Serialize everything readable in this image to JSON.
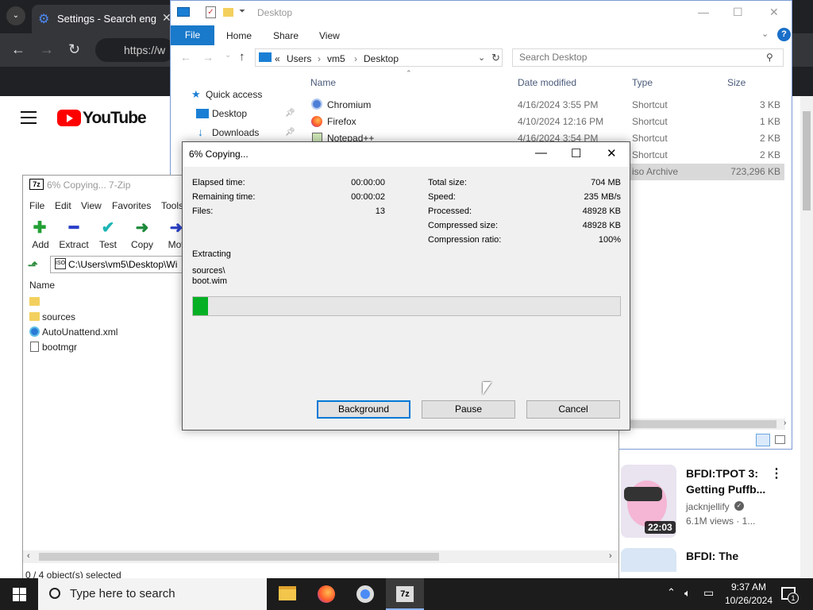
{
  "browser": {
    "tab_title": "Settings - Search engi",
    "url": "https://w",
    "youtube_logo_text": "YouTube",
    "video": {
      "title": "BFDI:TPOT 3: Getting Puffb...",
      "channel": "jacknjellify",
      "views": "6.1M views · 1...",
      "duration": "22:03"
    },
    "video2_title": "BFDI: The"
  },
  "explorer": {
    "title": "Desktop",
    "ribbon_tabs": [
      "File",
      "Home",
      "Share",
      "View"
    ],
    "breadcrumb": [
      "«",
      "Users",
      "vm5",
      "Desktop"
    ],
    "search_placeholder": "Search Desktop",
    "nav": [
      "Quick access",
      "Desktop",
      "Downloads"
    ],
    "columns": [
      "Name",
      "Date modified",
      "Type",
      "Size"
    ],
    "rows": [
      {
        "name": "Chromium",
        "date": "4/16/2024 3:55 PM",
        "type": "Shortcut",
        "size": "3 KB"
      },
      {
        "name": "Firefox",
        "date": "4/10/2024 12:16 PM",
        "type": "Shortcut",
        "size": "1 KB"
      },
      {
        "name": "Notepad++",
        "date": "4/16/2024 3:54 PM",
        "type": "Shortcut",
        "size": "2 KB"
      },
      {
        "name": "",
        "date": "",
        "type": "Shortcut",
        "size": "2 KB"
      },
      {
        "name": "",
        "date": "",
        "type": "iso Archive",
        "size": "723,296 KB"
      }
    ]
  },
  "zip_manager": {
    "title": "6% Copying... 7-Zip",
    "menu": [
      "File",
      "Edit",
      "View",
      "Favorites",
      "Tools"
    ],
    "toolbar": [
      "Add",
      "Extract",
      "Test",
      "Copy",
      "Mov"
    ],
    "path": "C:\\Users\\vm5\\Desktop\\Wi",
    "name_header": "Name",
    "items": [
      "",
      "sources",
      "AutoUnattend.xml",
      "bootmgr"
    ],
    "status": "0 / 4 object(s) selected"
  },
  "dialog": {
    "title": "6% Copying...",
    "left_stats": [
      {
        "label": "Elapsed time:",
        "value": "00:00:00"
      },
      {
        "label": "Remaining time:",
        "value": "00:00:02"
      },
      {
        "label": "Files:",
        "value": "13"
      }
    ],
    "right_stats": [
      {
        "label": "Total size:",
        "value": "704 MB"
      },
      {
        "label": "Speed:",
        "value": "235 MB/s"
      },
      {
        "label": "Processed:",
        "value": "48928 KB"
      },
      {
        "label": "Compressed size:",
        "value": "48928 KB"
      },
      {
        "label": "Compression ratio:",
        "value": "100%"
      }
    ],
    "operation": "Extracting",
    "current_path_line1": "sources\\",
    "current_path_line2": "boot.wim",
    "progress_fraction": 0.035,
    "buttons": {
      "background": "Background",
      "pause": "Pause",
      "cancel": "Cancel"
    }
  },
  "taskbar": {
    "search_placeholder": "Type here to search",
    "time": "9:37 AM",
    "date": "10/26/2024",
    "notification_count": "1"
  }
}
